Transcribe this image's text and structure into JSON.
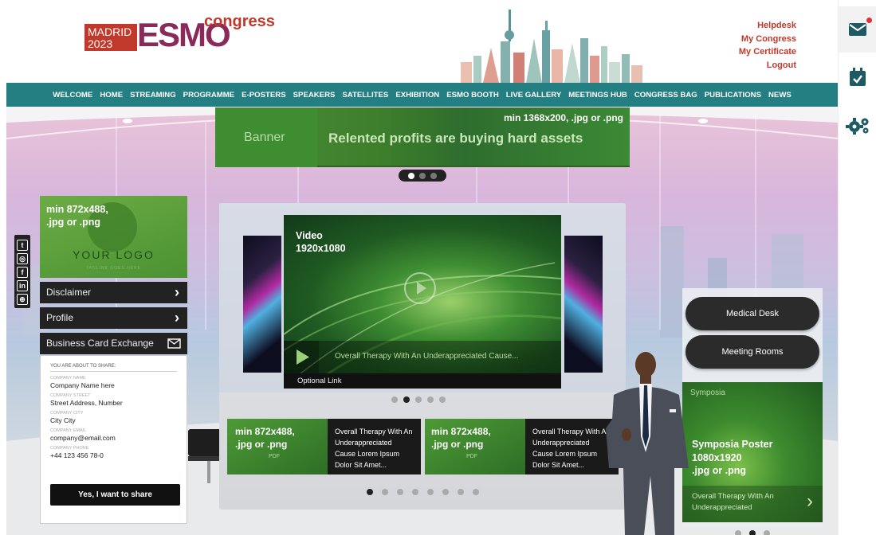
{
  "header": {
    "badge_line1": "MADRID",
    "badge_line2": "2023",
    "logo_text": "ESMO",
    "logo_suffix": "congress",
    "links": [
      "Helpdesk",
      "My Congress",
      "My Certificate",
      "Logout"
    ]
  },
  "nav": {
    "items": [
      "WELCOME",
      "HOME",
      "STREAMING",
      "PROGRAMME",
      "E-POSTERS",
      "SPEAKERS",
      "SATELLITES",
      "EXHIBITION",
      "ESMO BOOTH",
      "LIVE GALLERY",
      "MEETINGS HUB",
      "CONGRESS BAG",
      "PUBLICATIONS",
      "NEWS"
    ]
  },
  "banner": {
    "size_hint": "min 1368x200, .jpg or .png",
    "label": "Banner",
    "headline": "Relented profits are buying hard assets"
  },
  "logo_card": {
    "size_line1": "min 872x488,",
    "size_line2": ".jpg or .png",
    "logo_text": "YOUR LOGO",
    "tagline": "TAGLINE GOES HERE"
  },
  "side_menu": {
    "disclaimer": "Disclaimer",
    "profile": "Profile",
    "business_card": "Business Card Exchange"
  },
  "business_card_form": {
    "heading": "YOU ARE ABOUT TO SHARE:",
    "fields": [
      {
        "label": "COMPANY NAME",
        "value": "Company Name here"
      },
      {
        "label": "COMPANY STREET",
        "value": "Street Address, Number"
      },
      {
        "label": "COMPANY CITY",
        "value": "City City"
      },
      {
        "label": "COMPANY EMAIL",
        "value": "company@email.com"
      },
      {
        "label": "COMPANY PHONE",
        "value": "+44 123 456 78-0"
      }
    ],
    "share_button": "Yes, I want to share"
  },
  "video": {
    "title_line1": "Video",
    "title_line2": "1920x1080",
    "caption": "Overall Therapy With An Underappreciated Cause...",
    "optional_link": "Optional Link"
  },
  "documents": [
    {
      "size_line1": "min 872x488,",
      "size_line2": ".jpg or .png",
      "badge": "PDF",
      "text": "Overall Therapy With An Underappreciated Cause Lorem Ipsum Dolor Sit Amet..."
    },
    {
      "size_line1": "min 872x488,",
      "size_line2": ".jpg or .png",
      "badge": "PDF",
      "text": "Overall Therapy With An Underappreciated Cause Lorem Ipsum Dolor Sit Amet..."
    }
  ],
  "right_stand": {
    "medical_desk": "Medical Desk",
    "meeting_rooms": "Meeting Rooms",
    "poster_label": "Symposia",
    "poster_line1": "Symposia Poster",
    "poster_line2": "1080x1920",
    "poster_line3": ".jpg or .png",
    "poster_caption": "Overall Therapy With An Underappreciated"
  },
  "carousels": {
    "banner_active": 0,
    "banner_count": 3,
    "video_active": 1,
    "video_count": 5,
    "docs_active": 0,
    "docs_count": 8
  },
  "colors": {
    "nav_teal": "#247f83",
    "brand_red": "#c0392b",
    "accent_green": "#4b9232",
    "dark": "#222222"
  }
}
